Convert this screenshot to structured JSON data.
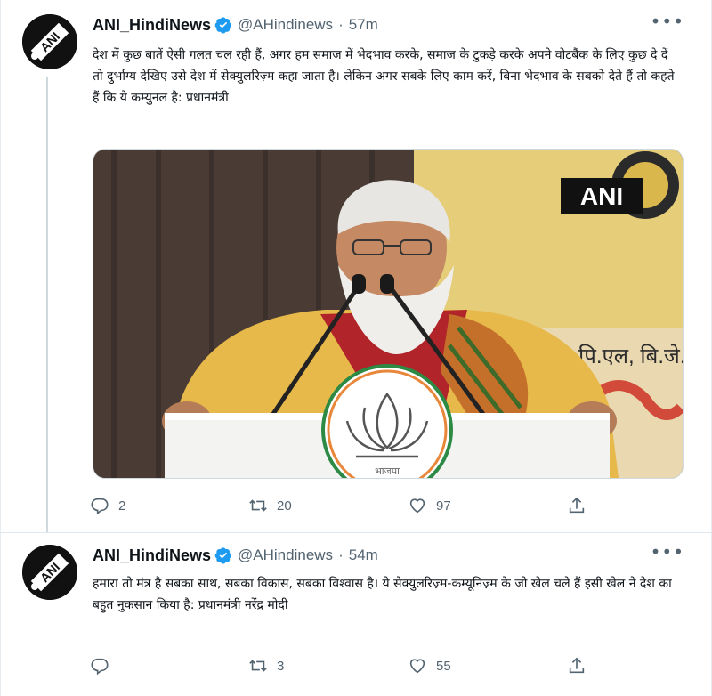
{
  "tweets": [
    {
      "name": "ANI_HindiNews",
      "handle": "@AHindinews",
      "separator": "·",
      "time": "57m",
      "text": "देश में कुछ बातें ऐसी गलत चल रही हैं, अगर हम समाज में भेदभाव करके, समाज के टुकड़े करके अपने वोटबैंक के लिए कुछ दे दें तो दुर्भाग्य देखिए उसे देश में सेक्युलरिज़्म कहा जाता है। लेकिन अगर सबके लिए काम करें, बिना भेदभाव के सबको देते हैं तो कहते हैं कि ये कम्युनल है: प्रधानमंत्री",
      "media": {
        "watermark": "ANI",
        "banner_text": "पि.एल, बि.जे.",
        "podium_text": "भाजपा"
      },
      "replies": "2",
      "retweets": "20",
      "likes": "97"
    },
    {
      "name": "ANI_HindiNews",
      "handle": "@AHindinews",
      "separator": "·",
      "time": "54m",
      "text": "हमारा तो मंत्र है सबका साथ, सबका विकास, सबका विश्वास है। ये सेक्युलरिज़्म-कम्यूनिज़्म के जो खेल चले हैं इसी खेल ने देश का बहुत नुकसान किया है: प्रधानमंत्री नरेंद्र मोदी",
      "replies": "",
      "retweets": "3",
      "likes": "55"
    }
  ],
  "avatar_text": "ANI",
  "icons": {
    "verified": "verified-badge-icon",
    "more": "more-options-icon",
    "reply": "reply-icon",
    "retweet": "retweet-icon",
    "like": "like-icon",
    "share": "share-icon"
  },
  "colors": {
    "verified": "#1d9bf0",
    "muted": "#536471"
  }
}
